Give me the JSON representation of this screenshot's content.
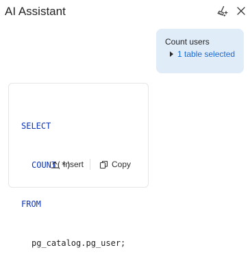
{
  "header": {
    "title": "AI Assistant",
    "clean_icon": "broom-sparkle-icon",
    "close_icon": "close-icon"
  },
  "user_message": {
    "text": "Count users",
    "context_label": "1 table selected",
    "context_icon": "caret-right-icon",
    "bubble_color": "#e1ecf9",
    "link_color": "#1a6ad6"
  },
  "code": {
    "lines": [
      {
        "keyword": "SELECT",
        "text": ""
      },
      {
        "keyword": "COUNT",
        "text": "(*)"
      },
      {
        "keyword": "FROM",
        "text": ""
      },
      {
        "keyword": "",
        "text": "pg_catalog.pg_user;"
      }
    ],
    "keyword_color": "#0a33b8"
  },
  "actions": {
    "insert_label": "Insert",
    "insert_icon": "insert-arrow-icon",
    "copy_label": "Copy",
    "copy_icon": "copy-icon"
  }
}
